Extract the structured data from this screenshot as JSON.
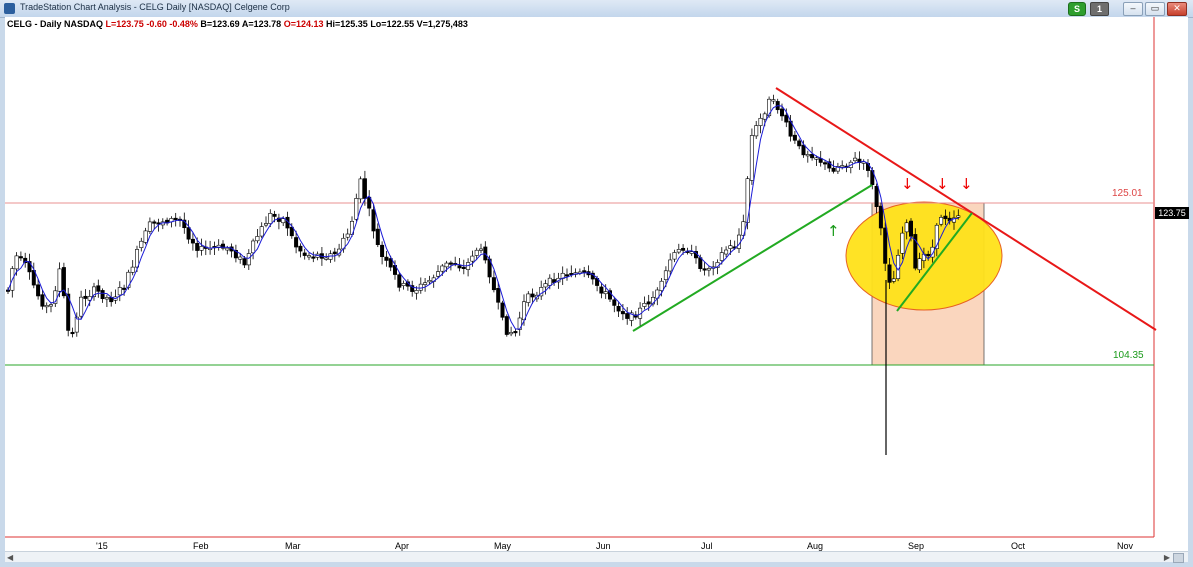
{
  "window": {
    "title": "TradeStation Chart Analysis - CELG Daily [NASDAQ] Celgene Corp",
    "status_button": "S",
    "count_button": "1",
    "minimize": "–",
    "restore": "▭",
    "close": "✕"
  },
  "info": {
    "symbol": "CELG - Daily  NASDAQ",
    "last": "L=123.75",
    "change": "-0.60",
    "change_pct": "-0.48%",
    "bid": "B=123.69",
    "ask": "A=123.78",
    "open": "O=124.13",
    "high": "Hi=125.35",
    "low": "Lo=122.55",
    "volume": "V=1,275,483"
  },
  "levels": {
    "resistance": "125.01",
    "support": "104.35",
    "last_price": "123.75"
  },
  "x_axis": [
    "'15",
    "Feb",
    "Mar",
    "Apr",
    "May",
    "Jun",
    "Jul",
    "Aug",
    "Sep",
    "Oct",
    "Nov"
  ],
  "colors": {
    "up_candle": "#ffffff",
    "down_candle": "#000000",
    "ma_line": "#1b1bd8",
    "resistance": "#e89090",
    "support": "#2aa52a",
    "trendline_down": "#e81818",
    "trendline_up": "#22aa22",
    "ellipse": "#ffe21a",
    "box_fill": "#f9cfb3"
  },
  "annotations": {
    "down_arrows": "↓",
    "up_arrow": "↑"
  },
  "scroll": {
    "left_arrow": "◀",
    "right_arrow": "▶"
  }
}
